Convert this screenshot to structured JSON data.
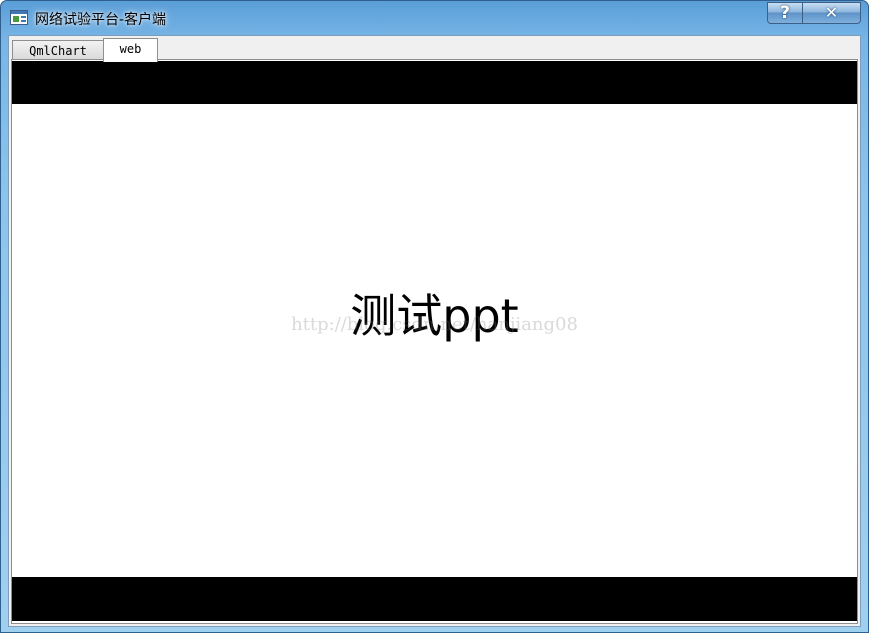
{
  "window": {
    "title": "网络试验平台-客户端",
    "help_label": "?",
    "close_label": "✕"
  },
  "tabs": [
    {
      "label": "QmlChart",
      "selected": false
    },
    {
      "label": "web",
      "selected": true
    }
  ],
  "slide": {
    "text": "测试ppt",
    "watermark": "http://blog.csdn.net/hanjiang08"
  },
  "icons": {
    "app": "window-app-icon",
    "help": "help-icon",
    "close": "close-icon"
  },
  "colors": {
    "title_gradient_top": "#5a9ed8",
    "slide_bar": "#000000",
    "slide_background": "#ffffff"
  }
}
